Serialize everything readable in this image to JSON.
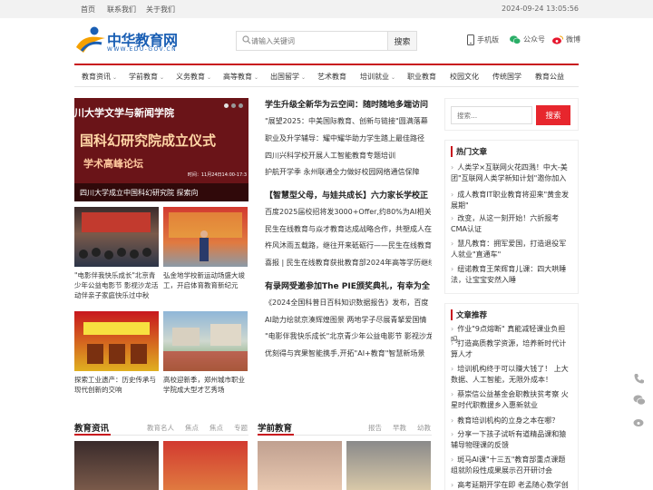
{
  "topbar": {
    "links": [
      "首页",
      "联系我们",
      "关于我们"
    ],
    "datetime": "2024-09-24 13:05:56"
  },
  "logo": {
    "name": "中华教育网",
    "url_text": "WWW.EDU-GOV.CN"
  },
  "search": {
    "placeholder": "请输入关键词",
    "button": "搜索"
  },
  "header_links": [
    {
      "label": "手机版",
      "icon": "phone-icon"
    },
    {
      "label": "公众号",
      "icon": "wechat-icon"
    },
    {
      "label": "微博",
      "icon": "weibo-icon"
    }
  ],
  "nav": [
    {
      "label": "教育资讯",
      "dropdown": true
    },
    {
      "label": "学前教育",
      "dropdown": true
    },
    {
      "label": "义务教育",
      "dropdown": true
    },
    {
      "label": "高等教育",
      "dropdown": true
    },
    {
      "label": "出国留学",
      "dropdown": true
    },
    {
      "label": "艺术教育",
      "dropdown": false
    },
    {
      "label": "培训就业",
      "dropdown": true
    },
    {
      "label": "职业教育",
      "dropdown": false
    },
    {
      "label": "校园文化",
      "dropdown": false
    },
    {
      "label": "传统国学",
      "dropdown": false
    },
    {
      "label": "教育公益",
      "dropdown": false
    }
  ],
  "slider": {
    "image_text": [
      "川大学文学与新闻学院",
      "国科幻研究院成立仪式",
      "学术高峰论坛",
      "时间：11月24日14:00-17:3"
    ],
    "caption": "四川大学成立中国科幻研究院 探索向"
  },
  "thumbs_row1": [
    {
      "caption": "\"电影伴我快乐成长\"北京青少年公益电影节 影视沙龙活动伴亲子家庭快乐过中秋"
    },
    {
      "caption": "弘金地学校新运动场盛大竣工，开启体育教育新纪元"
    }
  ],
  "thumbs_row2": [
    {
      "caption": "探索工业遗产：历史传承与现代创新的交响"
    },
    {
      "caption": "高校迎新季，郑州城市职业学院成大型才艺秀场"
    }
  ],
  "headline_groups": [
    {
      "title": "学生升级全新华为云空间：随时随地多端访问",
      "items": [
        "\"展望2025：中美国际教育、创新与链接\"圆满落幕",
        "职业及升学辅导：耀中耀华助力学生踏上最佳路径",
        "四川兴科学校开展人工智能教育专题培训",
        "护航开学季 永州联通全力做好校园网络通信保障"
      ]
    },
    {
      "title": "【智慧型父母，与娃共成长】六力家长学校正",
      "items": [
        "百度2025届校招将发3000+Offer,约80%为AI相关我",
        "民生在线教育与焱才教育达成战略合作，共塑成人在",
        "杵风沐雨五载路，继往开来砥砺行——民生在线教育",
        "喜报 | 民生在线教育获批教育部2024年高等学历继续"
      ]
    },
    {
      "title": "有录网受邀参加The PIE颁奖典礼，有幸为全",
      "items": [
        "《2024全国科普日百科知识数据报告》发布，百度",
        "AI助力绘就京湊辉煌图景 两地学子尽展青拏爱国情",
        "\"电影伴我快乐成长\"北京青少年公益电影节 影视沙龙",
        "优刻得与宾果智能携手,开拓\"AI+教育\"智慧新场景"
      ]
    }
  ],
  "side_search": {
    "placeholder": "搜索...",
    "button": "搜索"
  },
  "hot": {
    "title": "热门文章",
    "items": [
      "人类学×互联网火花四溅！中大-美团\"互联网人类学新知计划\"邀你加入",
      "成人教育IT职业教育将迎来\"黄金发展期\"",
      "改变，从这一刻开始！六折报考CMA认证",
      "慧凡教育：拥军爱国，打造退役军人就业\"直通车\"",
      "纽诺教育王荣辉育儿课：四大哄睡法，让宝宝安然入睡"
    ]
  },
  "recommend": {
    "title": "文章推荐",
    "items": [
      "作业\"9点熔断\" 真能减轻课业负担吗",
      "打造高质教学资源，培养新时代计算人才",
      "培训机构终于可以赚大钱了！ 上大数据、人工智能，无限外成本！",
      "蔡崇信公益基金会职教扶贫考察 火星时代职教援乡入惠新就业",
      "教育培训机构的立身之本在哪？",
      "分享一下孩子试听有道精品课和猿辅导物理课的反馈",
      "斑马AI课\"十三五\"教育部重点课题组就阶段性成果展示召开研讨会",
      "高考延期开学在即 老孟随心数学创"
    ]
  },
  "sections": [
    {
      "title": "教育资讯",
      "links": [
        "教育名人",
        "焦点",
        "焦点",
        "专题"
      ]
    },
    {
      "title": "学前教育",
      "links": [
        "报告",
        "早教",
        "幼教"
      ]
    }
  ]
}
